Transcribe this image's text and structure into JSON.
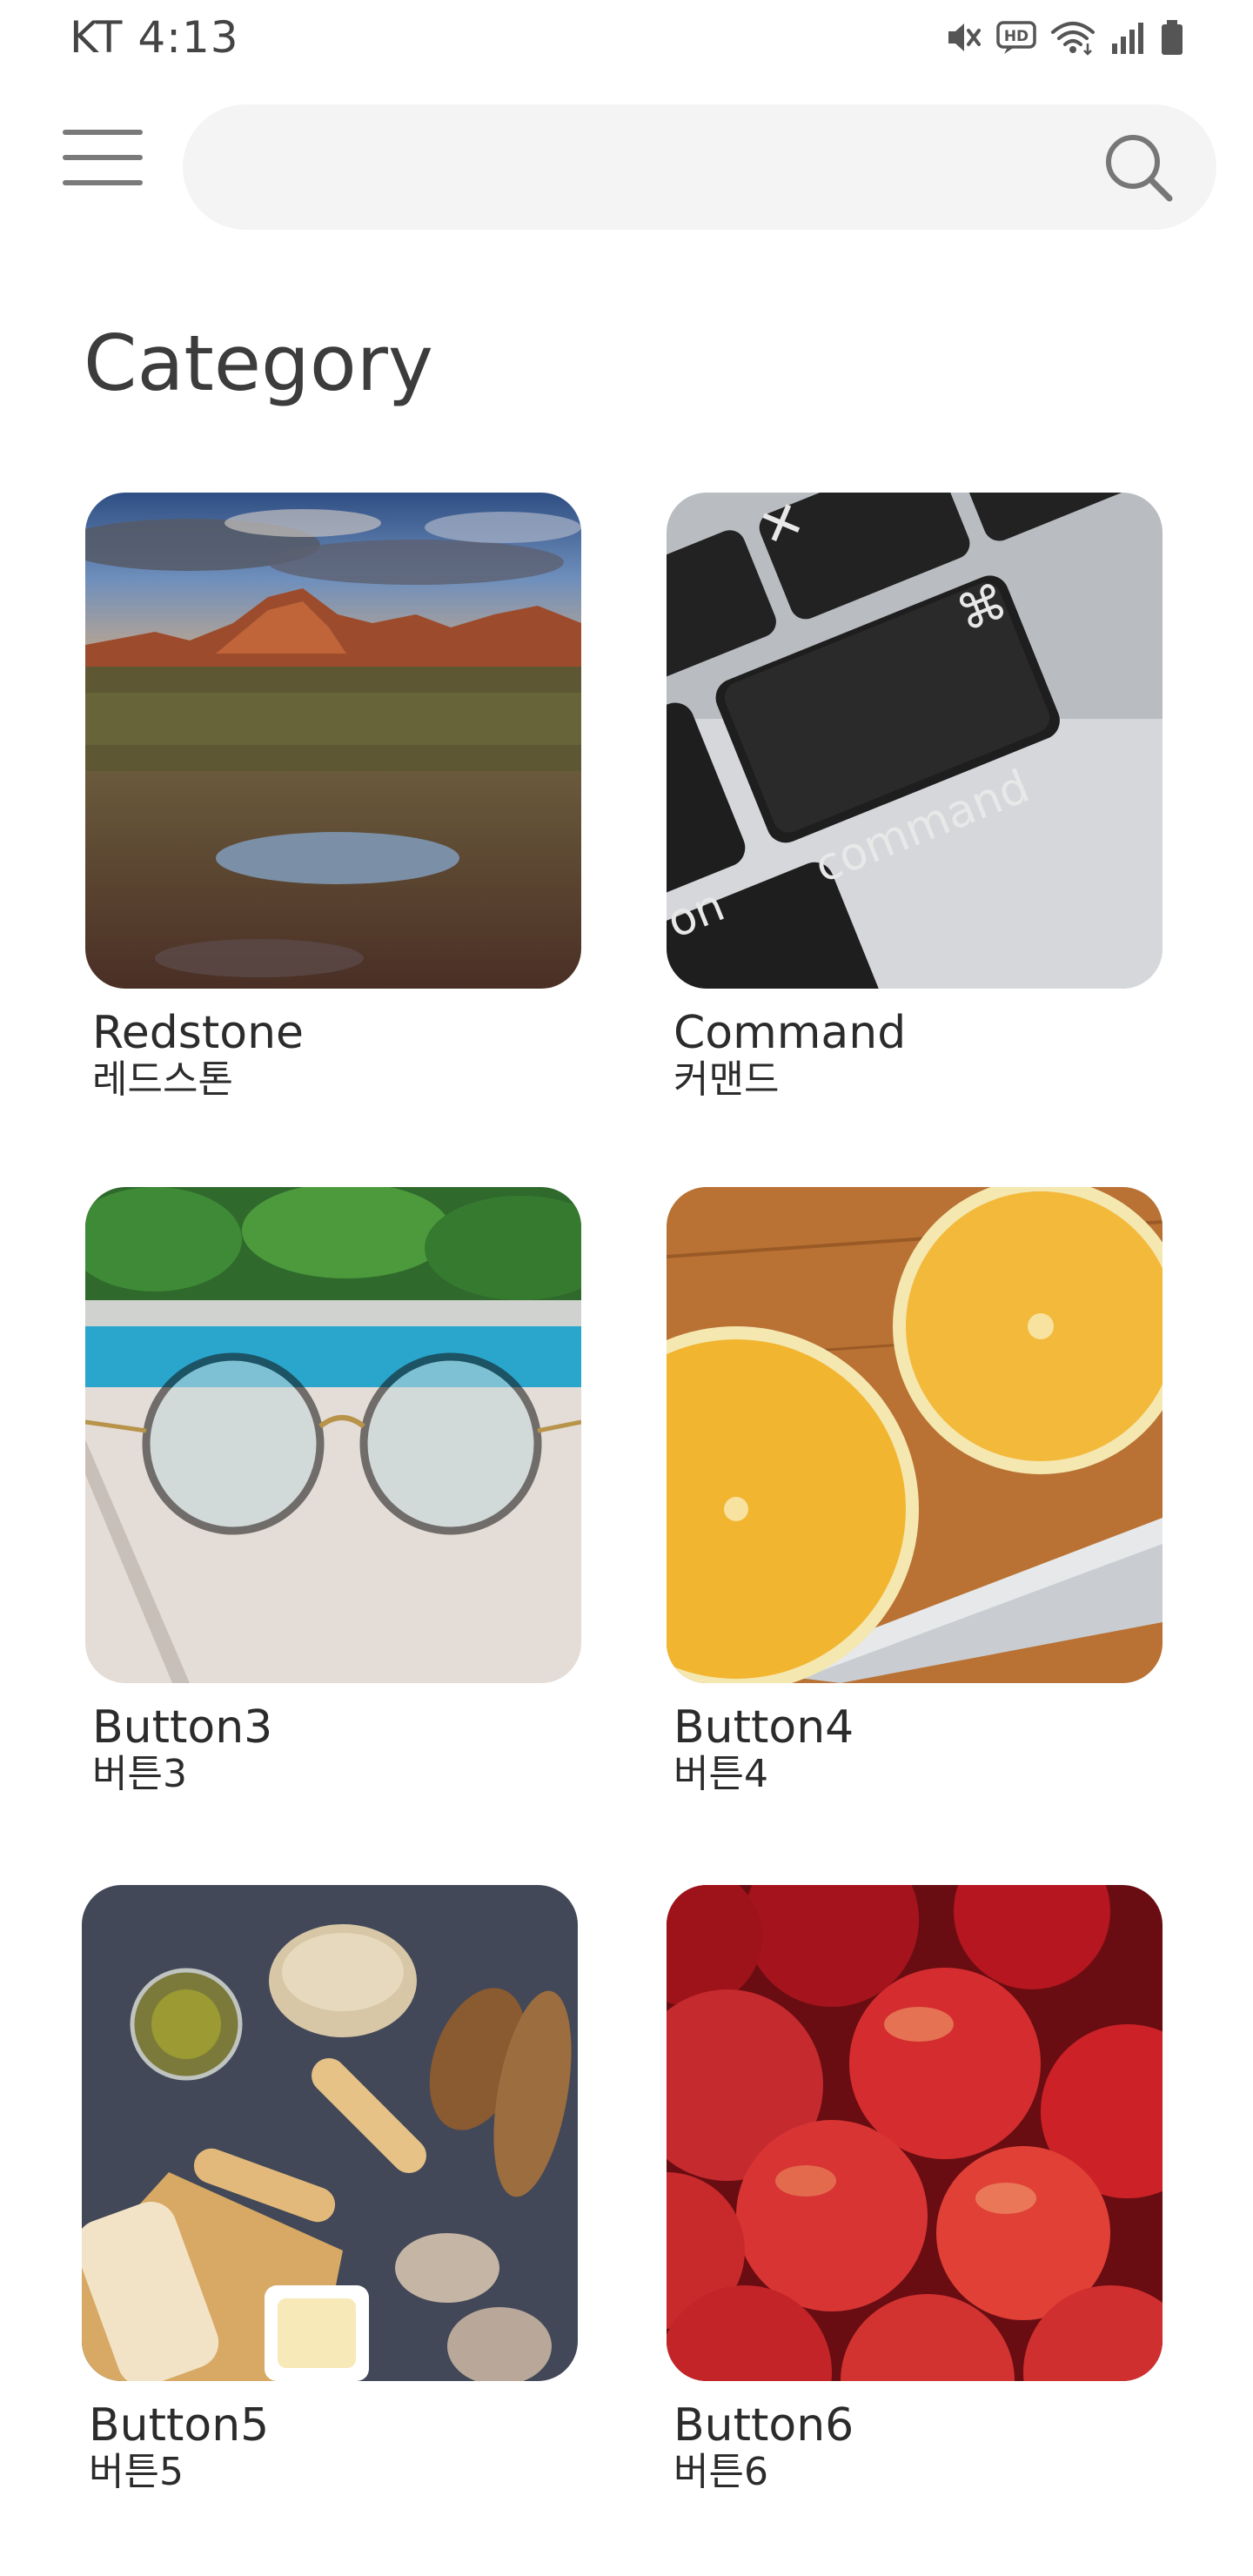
{
  "status_bar": {
    "carrier_time": "KT 4:13",
    "icons": [
      "mute-icon",
      "hd-voice-icon",
      "wifi-icon",
      "signal-icon",
      "battery-icon"
    ],
    "hd_label": "HD"
  },
  "header": {
    "menu_icon": "hamburger-menu-icon",
    "search": {
      "value": "",
      "placeholder": "",
      "icon": "search-icon"
    }
  },
  "main": {
    "title": "Category",
    "categories": [
      {
        "label": "Redstone",
        "sublabel": "레드스톤",
        "image": "red rock mountain landscape"
      },
      {
        "label": "Command",
        "sublabel": "커맨드",
        "image": "keyboard command key"
      },
      {
        "label": "Button3",
        "sublabel": "버튼3",
        "image": "eyeglasses by the pool"
      },
      {
        "label": "Button4",
        "sublabel": "버튼4",
        "image": "lemon halves on cutting board"
      },
      {
        "label": "Button5",
        "sublabel": "버튼5",
        "image": "bread and olive oil on dark table"
      },
      {
        "label": "Button6",
        "sublabel": "버튼6",
        "image": "red apples"
      }
    ]
  },
  "colors": {
    "background": "#ffffff",
    "search_bg": "#f4f4f4",
    "text": "#333333",
    "icon_gray": "#777777"
  }
}
